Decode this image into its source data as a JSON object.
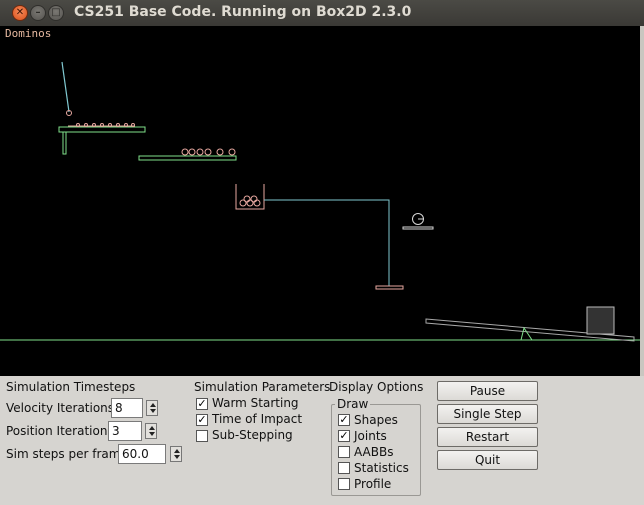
{
  "window": {
    "title": "CS251 Base Code. Running on Box2D 2.3.0",
    "controls": [
      "close",
      "minimize",
      "maximize"
    ]
  },
  "canvas": {
    "test_name": "Dominos",
    "background": "#000000"
  },
  "timesteps": {
    "heading": "Simulation Timesteps",
    "velocity_label": "Velocity Iterations",
    "velocity_value": "8",
    "position_label": "Position Iterations",
    "position_value": "3",
    "sim_steps_label": "Sim steps per frame",
    "sim_steps_value": "60.0"
  },
  "parameters": {
    "heading": "Simulation Parameters",
    "options": [
      {
        "label": "Warm Starting",
        "checked": true
      },
      {
        "label": "Time of Impact",
        "checked": true
      },
      {
        "label": "Sub-Stepping",
        "checked": false
      }
    ]
  },
  "display": {
    "heading": "Display Options",
    "group_title": "Draw",
    "options": [
      {
        "label": "Shapes",
        "checked": true
      },
      {
        "label": "Joints",
        "checked": true
      },
      {
        "label": "AABBs",
        "checked": false
      },
      {
        "label": "Statistics",
        "checked": false
      },
      {
        "label": "Profile",
        "checked": false
      }
    ]
  },
  "buttons": {
    "pause": "Pause",
    "single_step": "Single Step",
    "restart": "Restart",
    "quit": "Quit"
  },
  "colors": {
    "static_body": "#7fe08a",
    "dynamic_body": "#e8a8a0",
    "joint": "#80c8d0",
    "kinematic": "#9090a0"
  }
}
